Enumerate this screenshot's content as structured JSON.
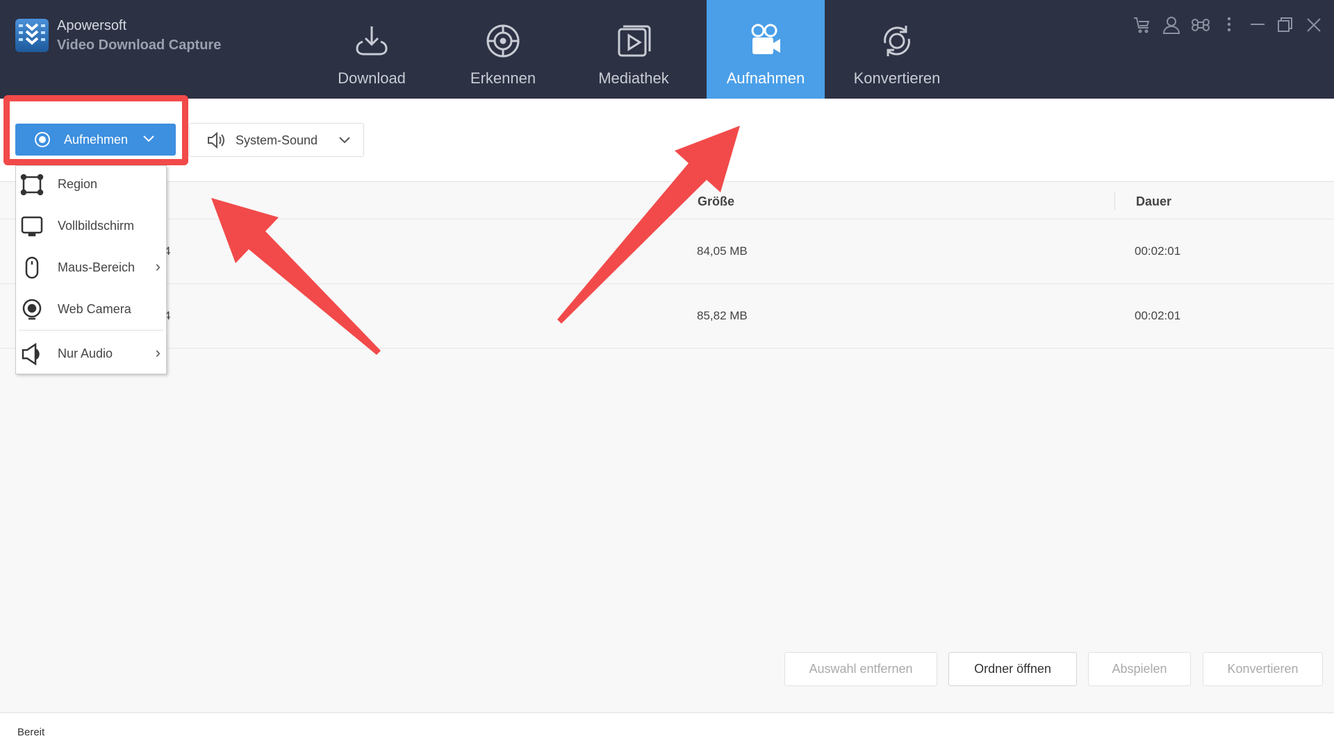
{
  "app": {
    "name_line1": "Apowersoft",
    "name_line2": "Video Download Capture"
  },
  "nav": {
    "tabs": [
      {
        "label": "Download"
      },
      {
        "label": "Erkennen"
      },
      {
        "label": "Mediathek"
      },
      {
        "label": "Aufnahmen",
        "active": true
      },
      {
        "label": "Konvertieren"
      }
    ]
  },
  "window_icons": [
    "cart-icon",
    "user-icon",
    "command-icon",
    "more-icon",
    "minimize-icon",
    "maximize-icon",
    "close-icon"
  ],
  "toolbar": {
    "record_label": "Aufnehmen",
    "sound_label": "System-Sound"
  },
  "menu": {
    "items": [
      {
        "label": "Region"
      },
      {
        "label": "Vollbildschirm"
      },
      {
        "label": "Maus-Bereich",
        "submenu": true
      },
      {
        "label": "Web Camera"
      },
      {
        "label": "Nur Audio",
        "submenu": true
      }
    ]
  },
  "table": {
    "headers": {
      "size": "Größe",
      "duration": "Dauer"
    },
    "rows": [
      {
        "name_fragment": "4",
        "size": "84,05 MB",
        "duration": "00:02:01"
      },
      {
        "name_fragment": "4",
        "size": "85,82 MB",
        "duration": "00:02:01"
      }
    ]
  },
  "actions": {
    "remove": "Auswahl entfernen",
    "open_folder": "Ordner öffnen",
    "play": "Abspielen",
    "convert": "Konvertieren"
  },
  "status": "Bereit",
  "colors": {
    "header": "#2c3144",
    "accent": "#4a9fe8",
    "annotation": "#f24a4a"
  }
}
